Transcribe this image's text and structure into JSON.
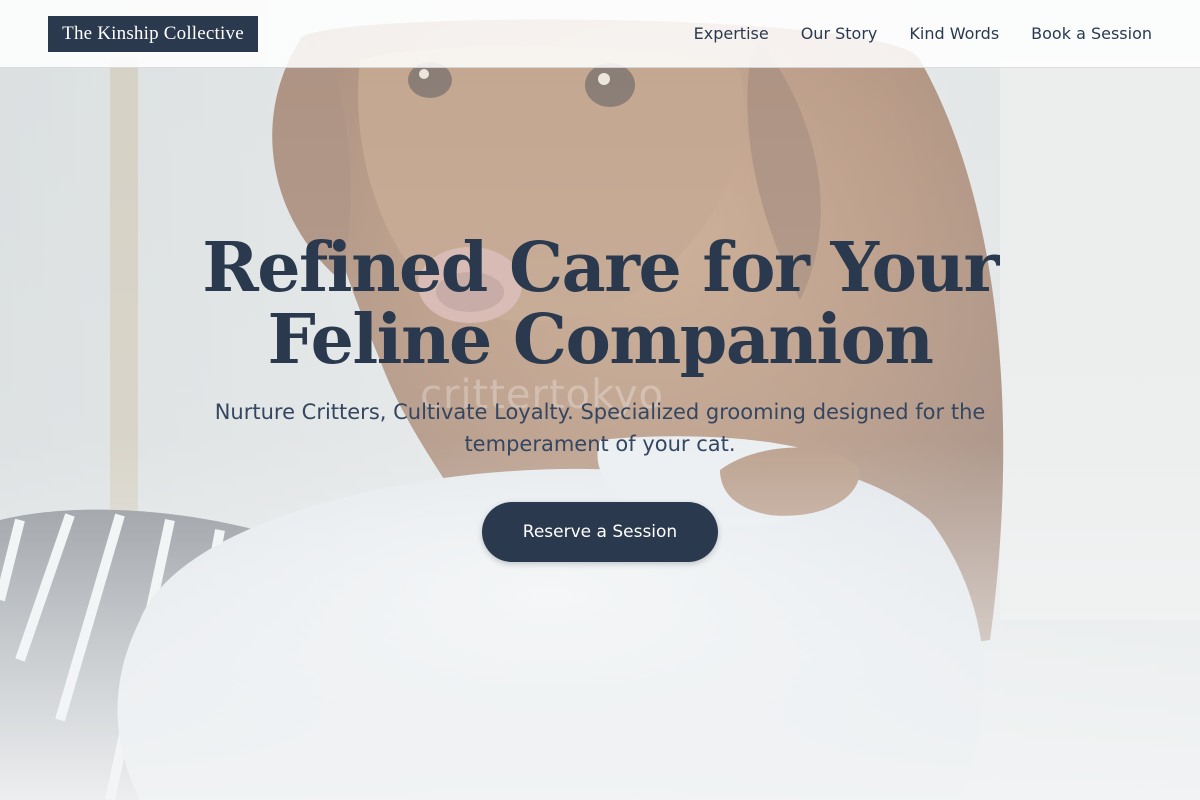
{
  "brand": {
    "name": "The Kinship Collective"
  },
  "nav": {
    "items": [
      {
        "label": "Expertise"
      },
      {
        "label": "Our Story"
      },
      {
        "label": "Kind Words"
      },
      {
        "label": "Book a Session"
      }
    ]
  },
  "hero": {
    "headline_line1": "Refined Care for Your",
    "headline_line2": "Feline Companion",
    "subheadline": "Nurture Critters, Cultivate Loyalty. Specialized grooming designed for the temperament of your cat.",
    "cta_label": "Reserve a Session",
    "watermark_text": "crittertokyo",
    "image_subject": "dog-on-towel-photo"
  },
  "colors": {
    "primary": "#2a394e",
    "background": "#f2f4f5",
    "header_bg": "#ffffff"
  }
}
